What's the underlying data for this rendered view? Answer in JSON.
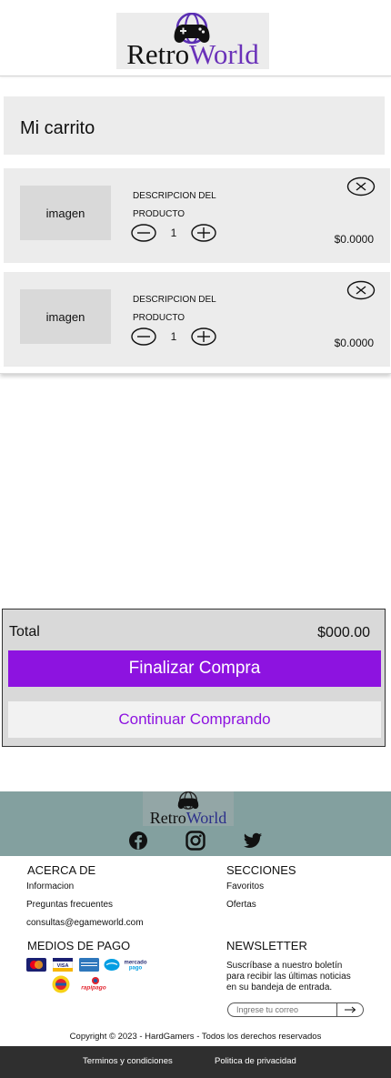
{
  "header": {
    "logo_word1": "Retro",
    "logo_word2": "World"
  },
  "cart": {
    "title": "Mi carrito",
    "items": [
      {
        "image_label": "imagen",
        "desc_line1": "DESCRIPCION DEL",
        "desc_line2": "PRODUCTO",
        "quantity": "1",
        "price": "$0.0000"
      },
      {
        "image_label": "imagen",
        "desc_line1": "DESCRIPCION DEL",
        "desc_line2": "PRODUCTO",
        "quantity": "1",
        "price": "$0.0000"
      }
    ]
  },
  "summary": {
    "total_label": "Total",
    "total_value": "$000.00",
    "finalize_label": "Finalizar Compra",
    "continue_label": "Continuar Comprando"
  },
  "footer": {
    "logo_word1": "Retro",
    "logo_word2": "World",
    "social_icons": [
      "facebook-icon",
      "instagram-icon",
      "twitter-icon"
    ],
    "about": {
      "heading": "ACERCA DE",
      "links": [
        "Informacion",
        "Preguntas frecuentes",
        "consultas@egameworld.com"
      ]
    },
    "sections": {
      "heading": "SECCIONES",
      "links": [
        "Favoritos",
        "Ofertas"
      ]
    },
    "payment": {
      "heading": "MEDIOS DE PAGO",
      "methods": [
        "mastercard-icon",
        "visa-icon",
        "amex-icon",
        "mercado-pago-icon",
        "pago-facil-icon",
        "rapipago-icon"
      ]
    },
    "newsletter": {
      "heading": "NEWSLETTER",
      "text_line1": "Suscríbase a nuestro boletín",
      "text_line2": "para recibir las últimas noticias",
      "text_line3": "en su bandeja de entrada.",
      "placeholder": "Ingrese tu correo"
    },
    "copyright": "Copyright © 2023 - HardGamers - Todos los derechos reservados",
    "terms": "Terminos y condiciones",
    "privacy": "Politica de privacidad"
  },
  "colors": {
    "accent": "#8d13e0",
    "logo_purple": "#6a31b9",
    "footer_top": "#83a09f",
    "footer_bottom": "#2f2f2f",
    "panel": "#ececec"
  }
}
